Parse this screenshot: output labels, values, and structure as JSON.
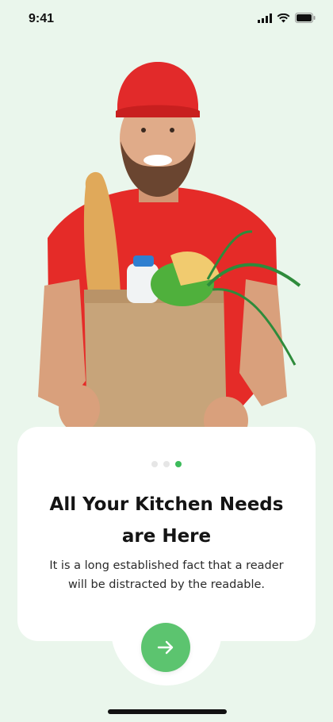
{
  "status_bar": {
    "time": "9:41"
  },
  "onboarding": {
    "title_line1": "All Your Kitchen Needs",
    "title_line2": "are Here",
    "description_line1": "It is a long established fact that a reader",
    "description_line2": "will be distracted by the readable.",
    "page_indicator": {
      "total": 3,
      "active_index": 2
    }
  },
  "colors": {
    "background": "#eaf6ec",
    "accent_green": "#5cc46f",
    "active_dot": "#3dbb5b"
  },
  "icons": {
    "next": "arrow-right-icon",
    "signal": "signal-icon",
    "wifi": "wifi-icon",
    "battery": "battery-icon"
  }
}
